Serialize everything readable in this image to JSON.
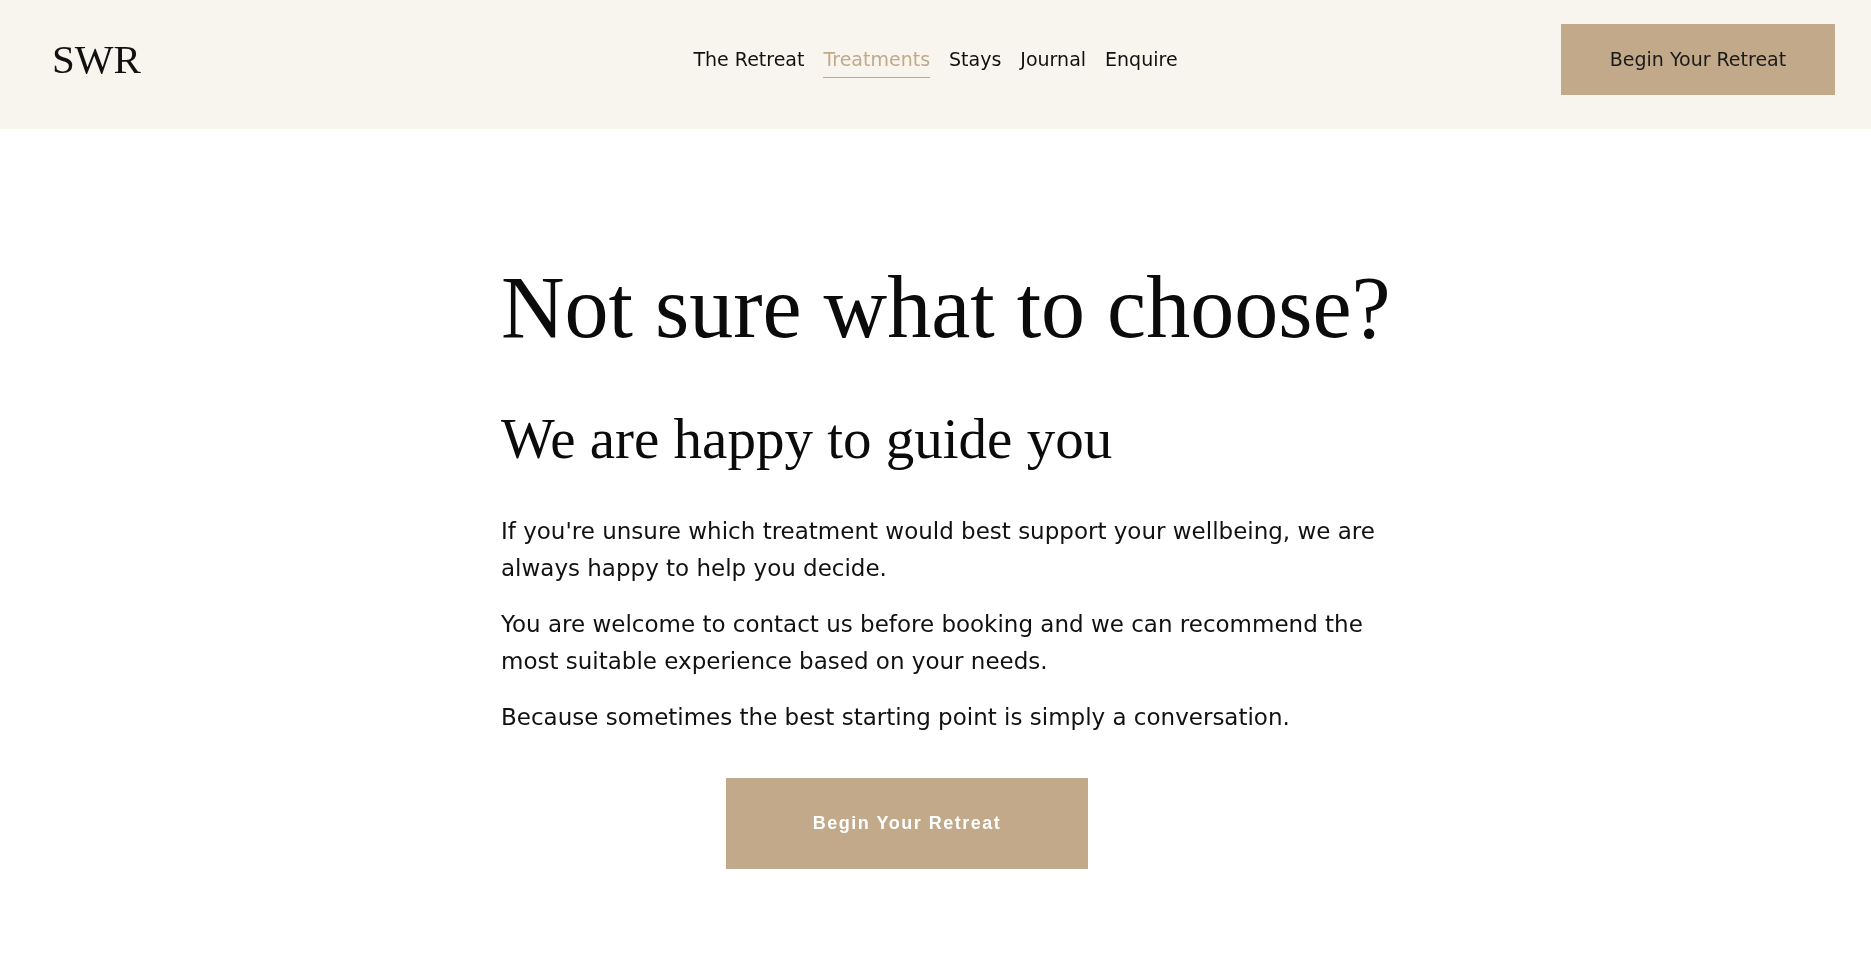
{
  "header": {
    "logo": "SWR",
    "nav": [
      {
        "label": "The Retreat",
        "selected": false
      },
      {
        "label": "Treatments",
        "selected": true
      },
      {
        "label": "Stays",
        "selected": false
      },
      {
        "label": "Journal",
        "selected": false
      },
      {
        "label": "Enquire",
        "selected": false
      }
    ],
    "cta": "Begin Your Retreat"
  },
  "hero": {
    "title": "Not sure what to choose?",
    "subtitle": "We are happy to guide you",
    "paragraphs": [
      "If you're unsure which treatment would best support your wellbeing, we are always happy to help you decide.",
      "You are welcome to contact us before booking and we can recommend the most suitable experience based on your needs.",
      "Because sometimes the best starting point is simply a conversation."
    ],
    "cta": "Begin Your Retreat"
  }
}
